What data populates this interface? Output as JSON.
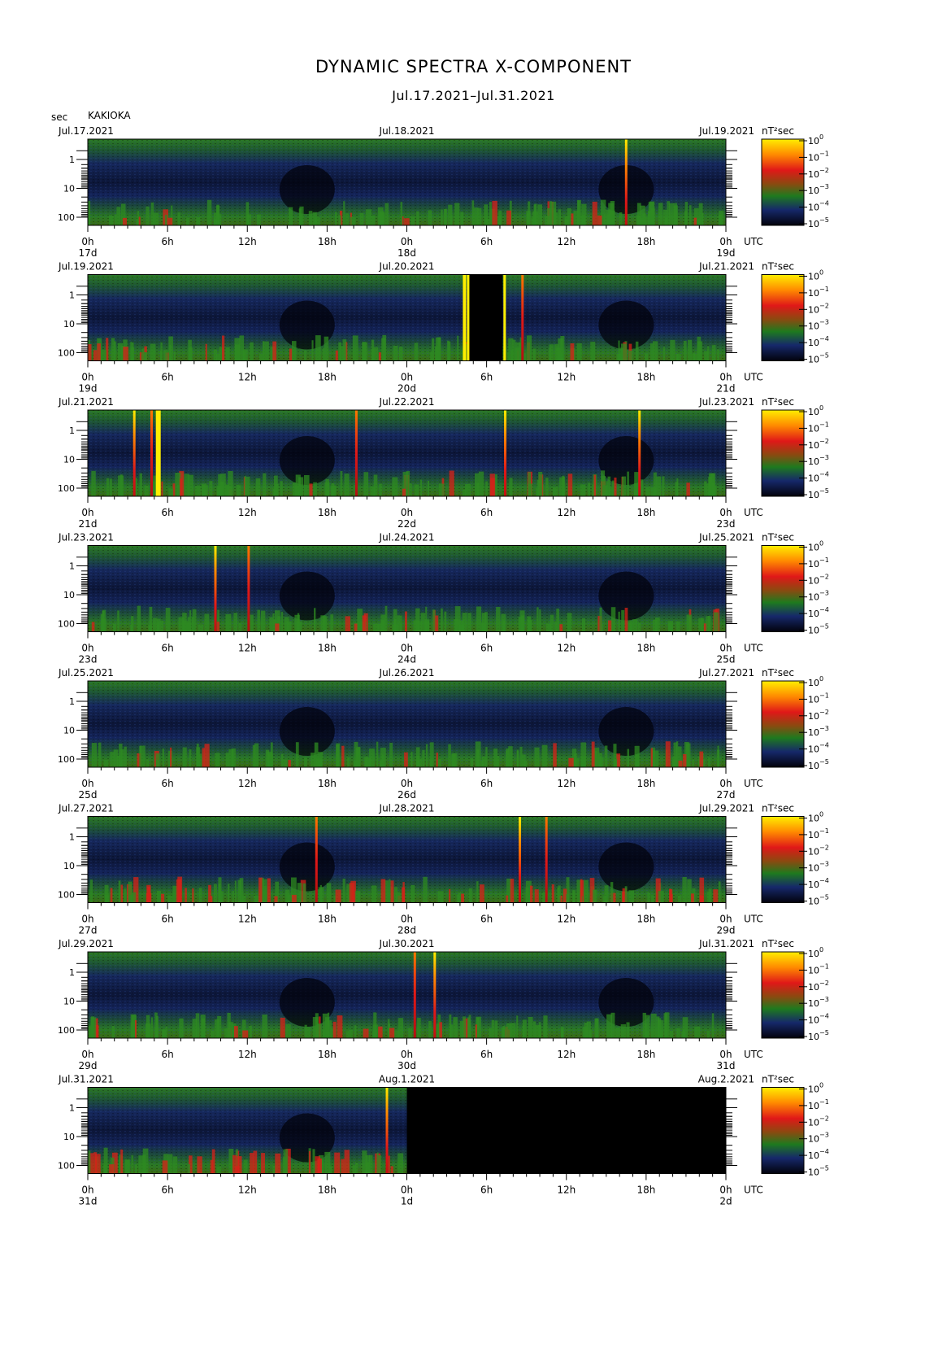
{
  "header": {
    "title": "DYNAMIC SPECTRA X-COMPONENT",
    "date_range": "Jul.17.2021–Jul.31.2021",
    "y_unit": "sec",
    "station": "KAKIOKA"
  },
  "colors": {
    "spectrum_low": "#000000",
    "spectrum_blue": "#1a2a78",
    "spectrum_green": "#1e7a1e",
    "spectrum_red": "#e01818",
    "spectrum_yellow": "#ffea00"
  },
  "chart_data": {
    "type": "heatmap",
    "y_axis": {
      "label": "sec",
      "ticks": [
        "1",
        "10",
        "100"
      ],
      "scale": "log"
    },
    "x_ticks": [
      "0h",
      "6h",
      "12h",
      "18h",
      "0h",
      "6h",
      "12h",
      "18h",
      "0h"
    ],
    "utc_label": "UTC",
    "colorbar": {
      "unit": "nT²sec",
      "tick_mantissa": "10",
      "tick_exponents": [
        "0",
        "−1",
        "−2",
        "−3",
        "−4",
        "−5"
      ]
    },
    "panels": [
      {
        "date_left": "Jul.17.2021",
        "date_mid": "Jul.18.2021",
        "date_right": "Jul.19.2021",
        "day_labels": [
          "17d",
          "18d",
          "19d"
        ],
        "events": [
          {
            "hour": 40.5,
            "intensity": "red-yellow"
          }
        ],
        "no_data": []
      },
      {
        "date_left": "Jul.19.2021",
        "date_mid": "Jul.20.2021",
        "date_right": "Jul.21.2021",
        "day_labels": [
          "19d",
          "20d",
          "21d"
        ],
        "events": [
          {
            "hour": 32.7,
            "intensity": "red"
          }
        ],
        "no_data": [
          {
            "start_hour": 28.7,
            "end_hour": 31.2
          }
        ]
      },
      {
        "date_left": "Jul.21.2021",
        "date_mid": "Jul.22.2021",
        "date_right": "Jul.23.2021",
        "day_labels": [
          "21d",
          "22d",
          "23d"
        ],
        "events": [
          {
            "hour": 3.5,
            "intensity": "red-yellow"
          },
          {
            "hour": 4.8,
            "intensity": "red"
          },
          {
            "hour": 5.3,
            "intensity": "yellow"
          },
          {
            "hour": 20.2,
            "intensity": "red"
          },
          {
            "hour": 31.4,
            "intensity": "red-yellow"
          },
          {
            "hour": 41.5,
            "intensity": "red-yellow"
          }
        ],
        "no_data": []
      },
      {
        "date_left": "Jul.23.2021",
        "date_mid": "Jul.24.2021",
        "date_right": "Jul.25.2021",
        "day_labels": [
          "23d",
          "24d",
          "25d"
        ],
        "events": [
          {
            "hour": 9.6,
            "intensity": "red-yellow"
          },
          {
            "hour": 12.1,
            "intensity": "red"
          }
        ],
        "no_data": []
      },
      {
        "date_left": "Jul.25.2021",
        "date_mid": "Jul.26.2021",
        "date_right": "Jul.27.2021",
        "day_labels": [
          "25d",
          "26d",
          "27d"
        ],
        "events": [],
        "no_data": []
      },
      {
        "date_left": "Jul.27.2021",
        "date_mid": "Jul.28.2021",
        "date_right": "Jul.29.2021",
        "day_labels": [
          "27d",
          "28d",
          "29d"
        ],
        "events": [
          {
            "hour": 17.2,
            "intensity": "red"
          },
          {
            "hour": 32.5,
            "intensity": "red-yellow"
          },
          {
            "hour": 34.5,
            "intensity": "red"
          }
        ],
        "no_data": []
      },
      {
        "date_left": "Jul.29.2021",
        "date_mid": "Jul.30.2021",
        "date_right": "Jul.31.2021",
        "day_labels": [
          "29d",
          "30d",
          "31d"
        ],
        "events": [
          {
            "hour": 24.6,
            "intensity": "red"
          },
          {
            "hour": 26.1,
            "intensity": "red-yellow"
          }
        ],
        "no_data": []
      },
      {
        "date_left": "Jul.31.2021",
        "date_mid": "Aug.1.2021",
        "date_right": "Aug.2.2021",
        "day_labels": [
          "31d",
          "1d",
          "2d"
        ],
        "events": [
          {
            "hour": 22.5,
            "intensity": "red-yellow"
          }
        ],
        "no_data": [
          {
            "start_hour": 24,
            "end_hour": 48
          }
        ]
      }
    ]
  }
}
